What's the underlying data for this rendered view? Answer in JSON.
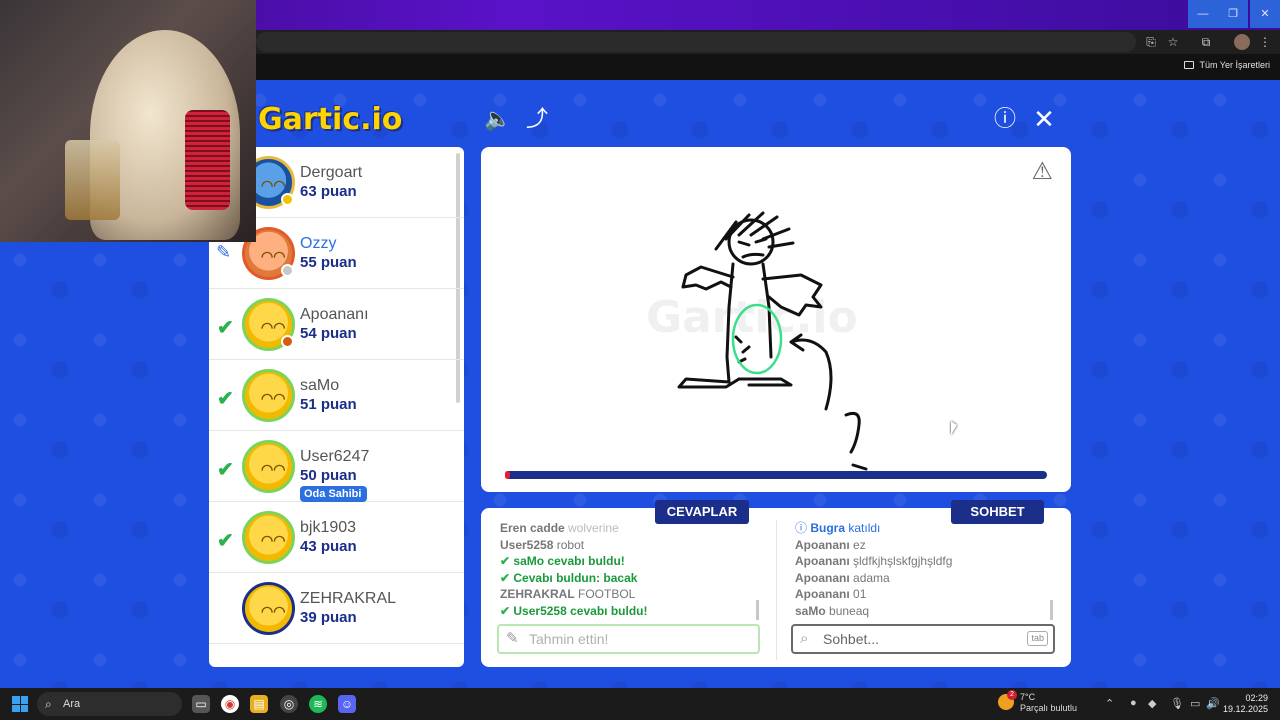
{
  "browser": {
    "bookmarks_folder": "Tüm Yer İşaretleri",
    "window_controls": [
      "minimize-icon",
      "maximize-icon",
      "close-icon"
    ]
  },
  "game": {
    "logo": "Gartic.io",
    "players": [
      {
        "name": "Dergoart",
        "score": "63 puan",
        "status": "none",
        "dot": "#f2c200"
      },
      {
        "name": "Ozzy",
        "score": "55 puan",
        "status": "drawing",
        "dot": "#c8c8c8"
      },
      {
        "name": "Apoananı",
        "score": "54 puan",
        "status": "guessed",
        "dot": "#d65a10"
      },
      {
        "name": "saMo",
        "score": "51 puan",
        "status": "guessed",
        "dot": ""
      },
      {
        "name": "User6247",
        "score": "50 puan",
        "status": "guessed",
        "dot": "",
        "tag": "Oda Sahibi"
      },
      {
        "name": "bjk1903",
        "score": "43 puan",
        "status": "guessed",
        "dot": ""
      },
      {
        "name": "ZEHRAKRAL",
        "score": "39 puan",
        "status": "none",
        "dot": ""
      }
    ],
    "canvas": {
      "watermark": "Gartic.io",
      "timer_progress": 0.01
    },
    "answers": {
      "tab_label": "CEVAPLAR",
      "messages": [
        {
          "user": "Eren cadde",
          "text": "wolverine",
          "style": "fade"
        },
        {
          "user": "User5258",
          "text": "robot",
          "style": "normal"
        },
        {
          "user": "saMo",
          "text": "cevabı buldu!",
          "style": "found"
        },
        {
          "user": "Cevabı buldun:",
          "text": "bacak",
          "style": "found"
        },
        {
          "user": "ZEHRAKRAL",
          "text": "FOOTBOL",
          "style": "normal"
        },
        {
          "user": "User5258",
          "text": "cevabı buldu!",
          "style": "found"
        }
      ],
      "input_placeholder": "Tahmin ettin!"
    },
    "chat": {
      "tab_label": "SOHBET",
      "messages": [
        {
          "user": "Bugra",
          "text": "katıldı",
          "style": "info"
        },
        {
          "user": "Apoananı",
          "text": "ez",
          "style": "normal"
        },
        {
          "user": "Apoananı",
          "text": "şldfkjhşlskfgjhşldfg",
          "style": "normal"
        },
        {
          "user": "Apoananı",
          "text": "adama",
          "style": "normal"
        },
        {
          "user": "Apoananı",
          "text": "01",
          "style": "normal"
        },
        {
          "user": "saMo",
          "text": "buneaq",
          "style": "normal"
        }
      ],
      "input_placeholder": "Sohbet...",
      "tab_key": "tab"
    }
  },
  "taskbar": {
    "search": "Ara",
    "weather_temp": "7°C",
    "weather_desc": "Parçalı bulutlu",
    "weather_badge": "2",
    "time": "02:29",
    "date": "19.12.2025"
  }
}
